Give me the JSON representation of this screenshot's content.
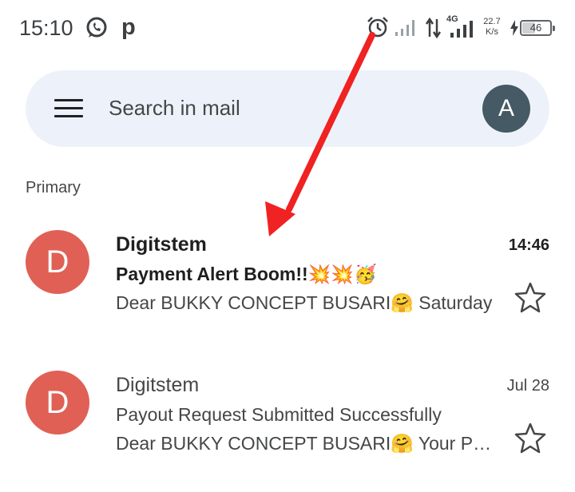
{
  "status_bar": {
    "time": "15:10",
    "network_type": "4G",
    "speed_value": "22.7",
    "speed_unit": "K/s",
    "battery_level": "46",
    "icons": [
      "whatsapp-icon",
      "p-icon",
      "alarm-icon",
      "signal-icon",
      "data-updown-icon",
      "signal-4g-icon",
      "charging-bolt-icon",
      "battery-icon"
    ]
  },
  "search": {
    "placeholder": "Search in mail",
    "avatar_initial": "A",
    "avatar_color": "#455a64"
  },
  "section": {
    "label": "Primary"
  },
  "emails": [
    {
      "avatar_initial": "D",
      "avatar_color": "#e06055",
      "sender": "Digitstem",
      "subject": "Payment Alert Boom!!💥💥🥳",
      "snippet": "Dear BUKKY CONCEPT BUSARI🤗 Saturday",
      "date": "14:46",
      "unread": true,
      "starred": false
    },
    {
      "avatar_initial": "D",
      "avatar_color": "#e06055",
      "sender": "Digitstem",
      "subject": "Payout Request Submitted Successfully",
      "snippet": "Dear BUKKY CONCEPT BUSARI🤗 Your Payout",
      "date": "Jul 28",
      "unread": false,
      "starred": false
    }
  ],
  "annotation": {
    "arrow_color": "#f02222"
  }
}
